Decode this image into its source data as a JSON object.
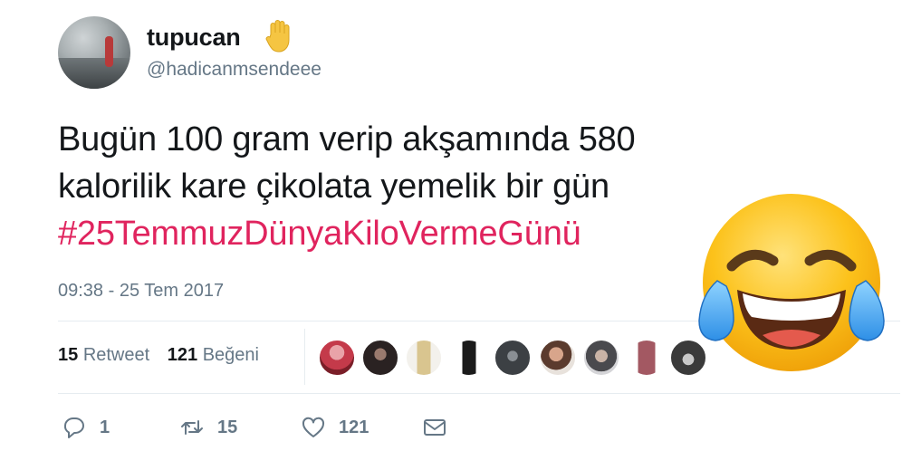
{
  "user": {
    "display_name": "tupucan",
    "handle": "@hadicanmsendeee",
    "badge_icon": "raised-hand-icon"
  },
  "tweet": {
    "text_line1": "Bugün 100 gram verip akşamında 580",
    "text_line2": "kalorilik kare çikolata yemelik bir gün",
    "hashtag": "#25TemmuzDünyaKiloVermeGünü",
    "timestamp": "09:38 - 25 Tem 2017"
  },
  "stats": {
    "retweets_count": "15",
    "retweets_label": "Retweet",
    "likes_count": "121",
    "likes_label": "Beğeni"
  },
  "likers": [
    {
      "name": "liker-avatar-1",
      "icon": "avatar"
    },
    {
      "name": "liker-avatar-2",
      "icon": "avatar"
    },
    {
      "name": "liker-avatar-3",
      "icon": "avatar"
    },
    {
      "name": "liker-avatar-4",
      "icon": "avatar"
    },
    {
      "name": "liker-avatar-5",
      "icon": "avatar"
    },
    {
      "name": "liker-avatar-6",
      "icon": "avatar"
    },
    {
      "name": "liker-avatar-7",
      "icon": "avatar"
    },
    {
      "name": "liker-avatar-8",
      "icon": "avatar"
    },
    {
      "name": "liker-avatar-9",
      "icon": "avatar"
    }
  ],
  "actions": {
    "reply_count": "1",
    "retweet_count": "15",
    "like_count": "121",
    "reply_icon": "reply-icon",
    "retweet_icon": "retweet-icon",
    "like_icon": "heart-icon",
    "dm_icon": "envelope-icon"
  },
  "overlay": {
    "emoji": "face-with-tears-of-joy-icon"
  },
  "colors": {
    "hashtag": "#e0245e",
    "secondary_text": "#657786",
    "primary_text": "#14171a",
    "divider": "#e6ecf0"
  }
}
